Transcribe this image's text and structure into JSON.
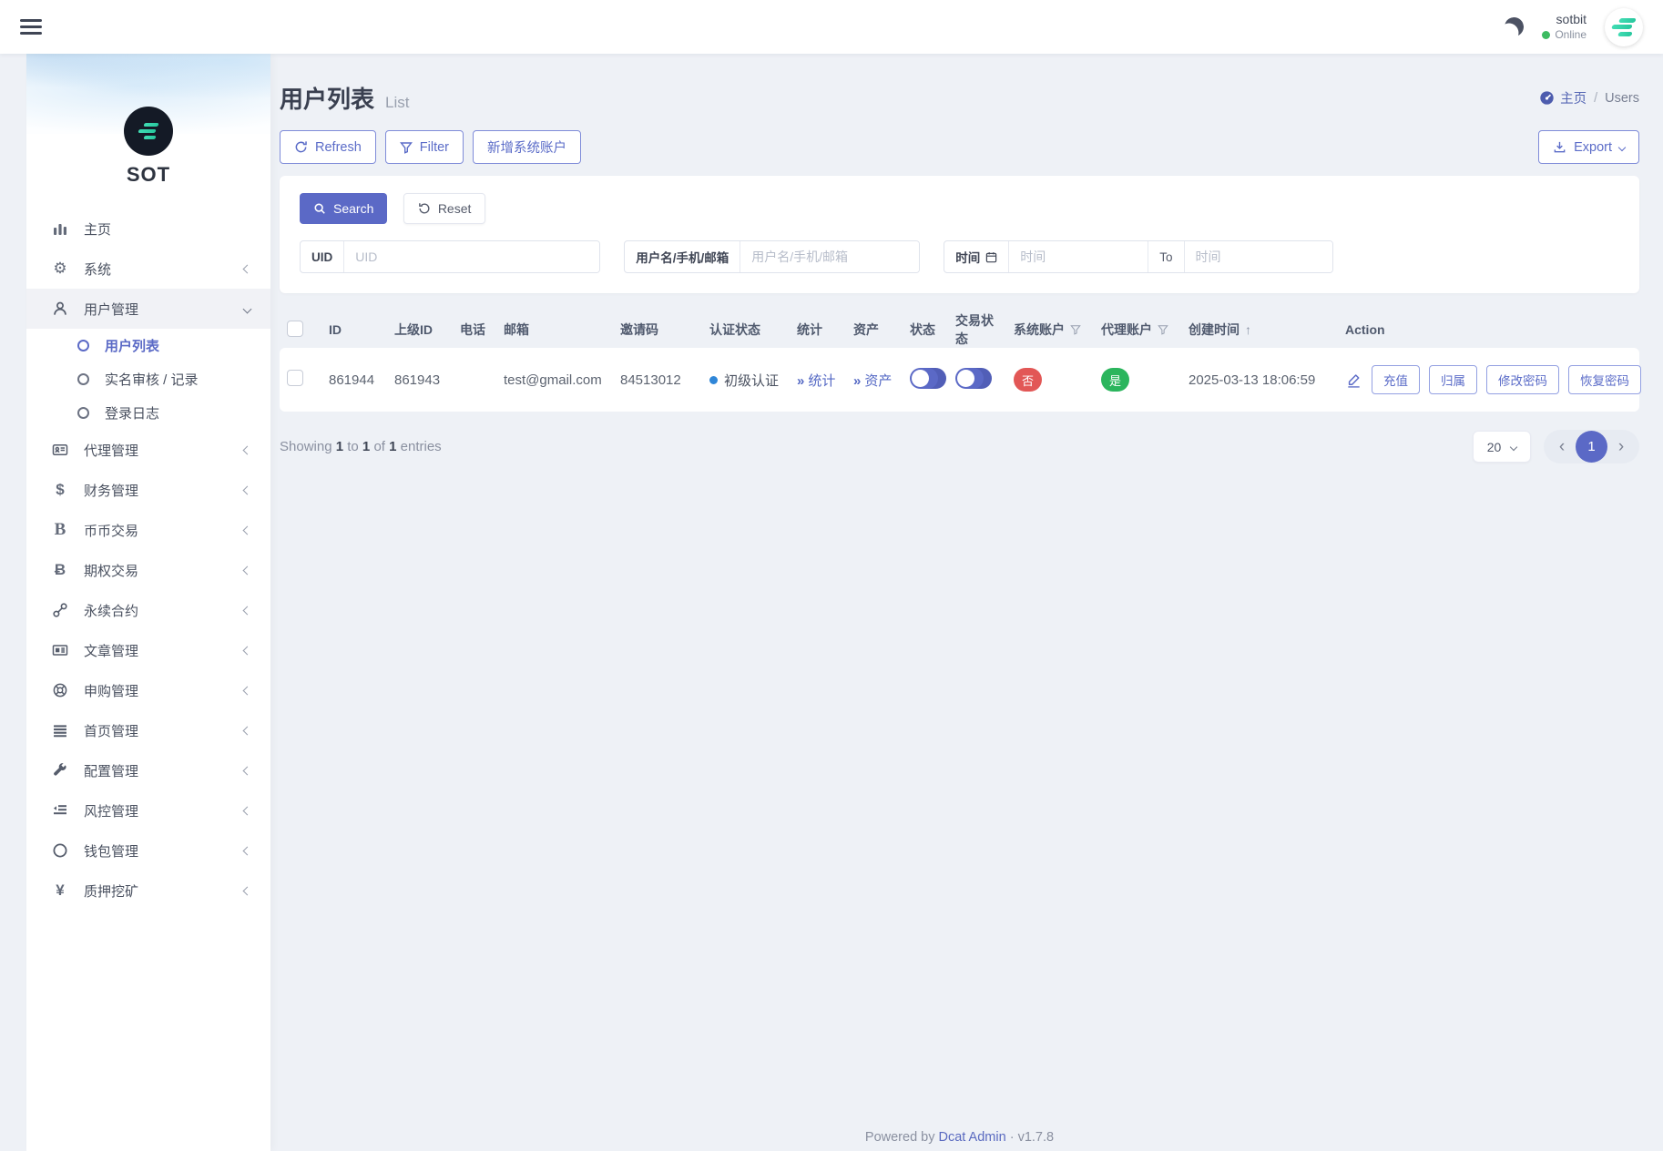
{
  "navbar": {
    "user": "sotbit",
    "status": "Online"
  },
  "sidebar": {
    "brand": "SOT",
    "items": [
      {
        "label": "主页",
        "icon": "chart-bar-icon"
      },
      {
        "label": "系统",
        "icon": "gear-icon"
      },
      {
        "label": "用户管理",
        "icon": "user-icon",
        "expanded": true,
        "children": [
          {
            "label": "用户列表",
            "active": true
          },
          {
            "label": "实名审核 / 记录"
          },
          {
            "label": "登录日志"
          }
        ]
      },
      {
        "label": "代理管理",
        "icon": "id-card-icon"
      },
      {
        "label": "财务管理",
        "icon": "dollar-icon",
        "glyph": "$"
      },
      {
        "label": "币币交易",
        "icon": "letter-b-icon",
        "glyph": "B"
      },
      {
        "label": "期权交易",
        "icon": "bitcoin-icon",
        "glyph": "Ƀ"
      },
      {
        "label": "永续合约",
        "icon": "chain-link-icon"
      },
      {
        "label": "文章管理",
        "icon": "newspaper-icon"
      },
      {
        "label": "申购管理",
        "icon": "life-ring-icon"
      },
      {
        "label": "首页管理",
        "icon": "lines-icon"
      },
      {
        "label": "配置管理",
        "icon": "wrench-icon"
      },
      {
        "label": "风控管理",
        "icon": "outdent-icon"
      },
      {
        "label": "钱包管理",
        "icon": "circle-icon"
      },
      {
        "label": "质押挖矿",
        "icon": "yen-icon",
        "glyph": "¥"
      }
    ]
  },
  "page": {
    "title": "用户列表",
    "subtitle": "List",
    "breadcrumb": {
      "home": "主页",
      "sep": "/",
      "current": "Users"
    }
  },
  "toolbar": {
    "refresh": "Refresh",
    "filter": "Filter",
    "add_account": "新增系统账户",
    "export": "Export"
  },
  "search": {
    "search_label": "Search",
    "reset_label": "Reset",
    "fields": {
      "uid": {
        "label": "UID",
        "placeholder": "UID"
      },
      "account": {
        "label": "用户名/手机/邮箱",
        "placeholder": "用户名/手机/邮箱"
      },
      "time": {
        "label": "时间",
        "from_placeholder": "时间",
        "to_label": "To",
        "to_placeholder": "时间"
      }
    }
  },
  "table": {
    "headers": [
      "ID",
      "上级ID",
      "电话",
      "邮箱",
      "邀请码",
      "认证状态",
      "统计",
      "资产",
      "状态",
      "交易状态",
      "系统账户",
      "代理账户",
      "创建时间",
      "Action"
    ],
    "row": {
      "id": "861944",
      "parent_id": "861943",
      "phone": "",
      "email": "test@gmail.com",
      "invite_code": "84513012",
      "auth_status": "初级认证",
      "stats_link": "统计",
      "assets_link": "资产",
      "status_toggle": "off",
      "trade_toggle": "off",
      "system_account": "否",
      "agent_account": "是",
      "created_at": "2025-03-13 18:06:59",
      "actions": [
        "充值",
        "归属",
        "修改密码",
        "恢复密码"
      ]
    }
  },
  "pagination": {
    "word_showing": "Showing",
    "from": "1",
    "word_to": "to",
    "to": "1",
    "word_of": "of",
    "total": "1",
    "word_entries": "entries",
    "per_page": "20",
    "page": "1"
  },
  "footer": {
    "powered": "Powered by",
    "brand": "Dcat Admin",
    "dot": "·",
    "version": "v1.7.8"
  },
  "colors": {
    "primary": "#5b69c6",
    "success": "#2bb55d",
    "danger": "#e25756",
    "info_dot": "#2f86d8",
    "online": "#3dbb61",
    "brand_teal": "#2fd0a5"
  }
}
